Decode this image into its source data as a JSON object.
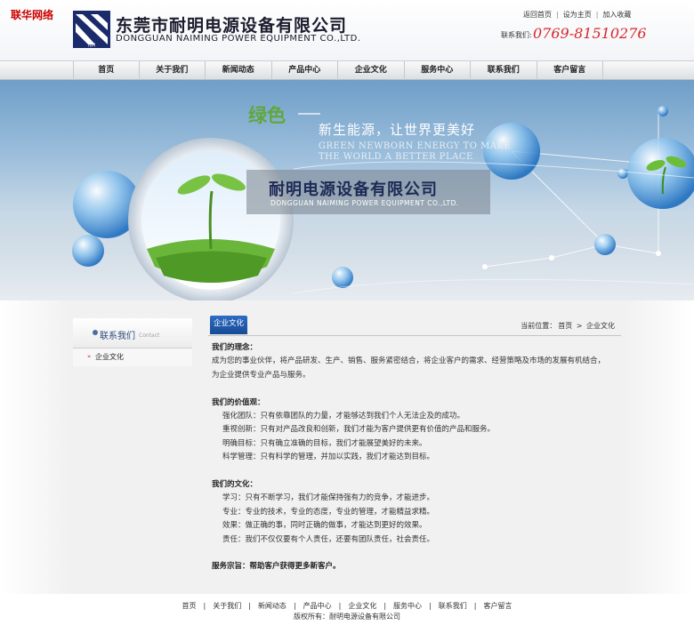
{
  "watermark": "联华网络",
  "header": {
    "company_cn": "东莞市耐明电源设备有限公司",
    "company_en": "DONGGUAN NAIMING POWER EQUIPMENT CO.,LTD.",
    "logo_text": "NM",
    "top_links": [
      "返回首页",
      "设为主页",
      "加入收藏"
    ],
    "phone_label": "联系我们:",
    "phone": "0769-81510276"
  },
  "nav": {
    "items": [
      "首页",
      "关于我们",
      "新闻动态",
      "产品中心",
      "企业文化",
      "服务中心",
      "联系我们",
      "客户留言"
    ]
  },
  "banner": {
    "green": "绿色",
    "slogan": "新生能源，让世界更美好",
    "en_line1": "GREEN NEWBORN ENERGY TO MAKE",
    "en_line2": "THE WORLD A BETTER PLACE",
    "company_cn": "耐明电源设备有限公司",
    "company_en": "DONGGUAN NAIMING POWER EQUIPMENT CO.,LTD."
  },
  "sidebar": {
    "title": "联系我们",
    "title_en": "Contact",
    "items": [
      "企业文化"
    ]
  },
  "main": {
    "tab": "企业文化",
    "crumb_label": "当前位置：",
    "crumb_home": "首页",
    "crumb_sep": ">",
    "crumb_current": "企业文化"
  },
  "article": {
    "h1": "我们的理念：",
    "p1": "成为您的事业伙伴，将产品研发、生产、销售、服务紧密结合，将企业客户的需求、经营策略及市场的发展有机结合，",
    "p1b": "为企业提供专业产品与服务。",
    "h2": "我们的价值观：",
    "v1": "强化团队：只有依靠团队的力量，才能够达到我们个人无法企及的成功。",
    "v2": "重视创新：只有对产品改良和创新，我们才能为客户提供更有价值的产品和服务。",
    "v3": "明确目标：只有确立准确的目标，我们才能展望美好的未来。",
    "v4": "科学管理：只有科学的管理，并加以实践，我们才能达到目标。",
    "h3": "我们的文化：",
    "c1": "学习：只有不断学习，我们才能保持强有力的竞争，才能进步。",
    "c2": "专业：专业的技术，专业的态度，专业的管理，才能精益求精。",
    "c3": "效果：做正确的事，同时正确的做事，才能达到更好的效果。",
    "c4": "责任：我们不仅仅要有个人责任，还要有团队责任，社会责任。",
    "h4": "服务宗旨：帮助客户获得更多新客户。"
  },
  "footer": {
    "links": [
      "首页",
      "关于我们",
      "新闻动态",
      "产品中心",
      "企业文化",
      "服务中心",
      "联系我们",
      "客户留言"
    ],
    "copyright": "版权所有：耐明电源设备有限公司"
  },
  "colors": {
    "phone": "#d8262b",
    "tab": "#1f5bb0",
    "banner_green": "#5fa83a",
    "watermark": "#cc0000"
  }
}
